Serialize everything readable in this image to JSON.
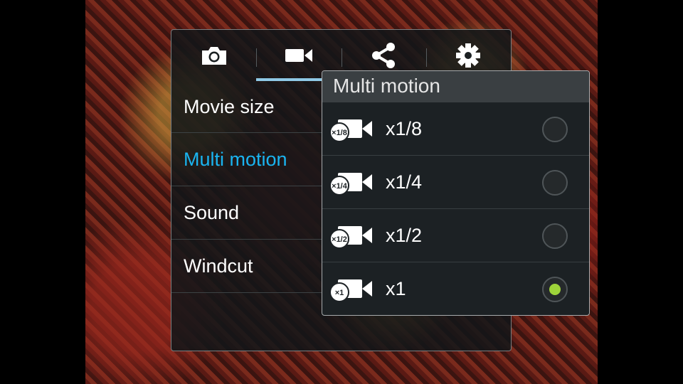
{
  "tabs": [
    {
      "icon": "camera-icon",
      "active": false
    },
    {
      "icon": "video-camera-icon",
      "active": true
    },
    {
      "icon": "share-icon",
      "active": false
    },
    {
      "icon": "gear-icon",
      "active": false
    }
  ],
  "menu": {
    "items": [
      {
        "label": "Movie size"
      },
      {
        "label": "Multi motion",
        "active": true
      },
      {
        "label": "Sound"
      },
      {
        "label": "Windcut"
      }
    ]
  },
  "popup": {
    "title": "Multi motion",
    "options": [
      {
        "label": "x1/8",
        "badge": "×1/8",
        "selected": false
      },
      {
        "label": "x1/4",
        "badge": "×1/4",
        "selected": false
      },
      {
        "label": "x1/2",
        "badge": "×1/2",
        "selected": false
      },
      {
        "label": "x1",
        "badge": "×1",
        "selected": true
      }
    ]
  },
  "colors": {
    "accent_active_text": "#1ab4f0",
    "tab_indicator": "#8fc9e6",
    "radio_selected": "#9ed43a"
  }
}
